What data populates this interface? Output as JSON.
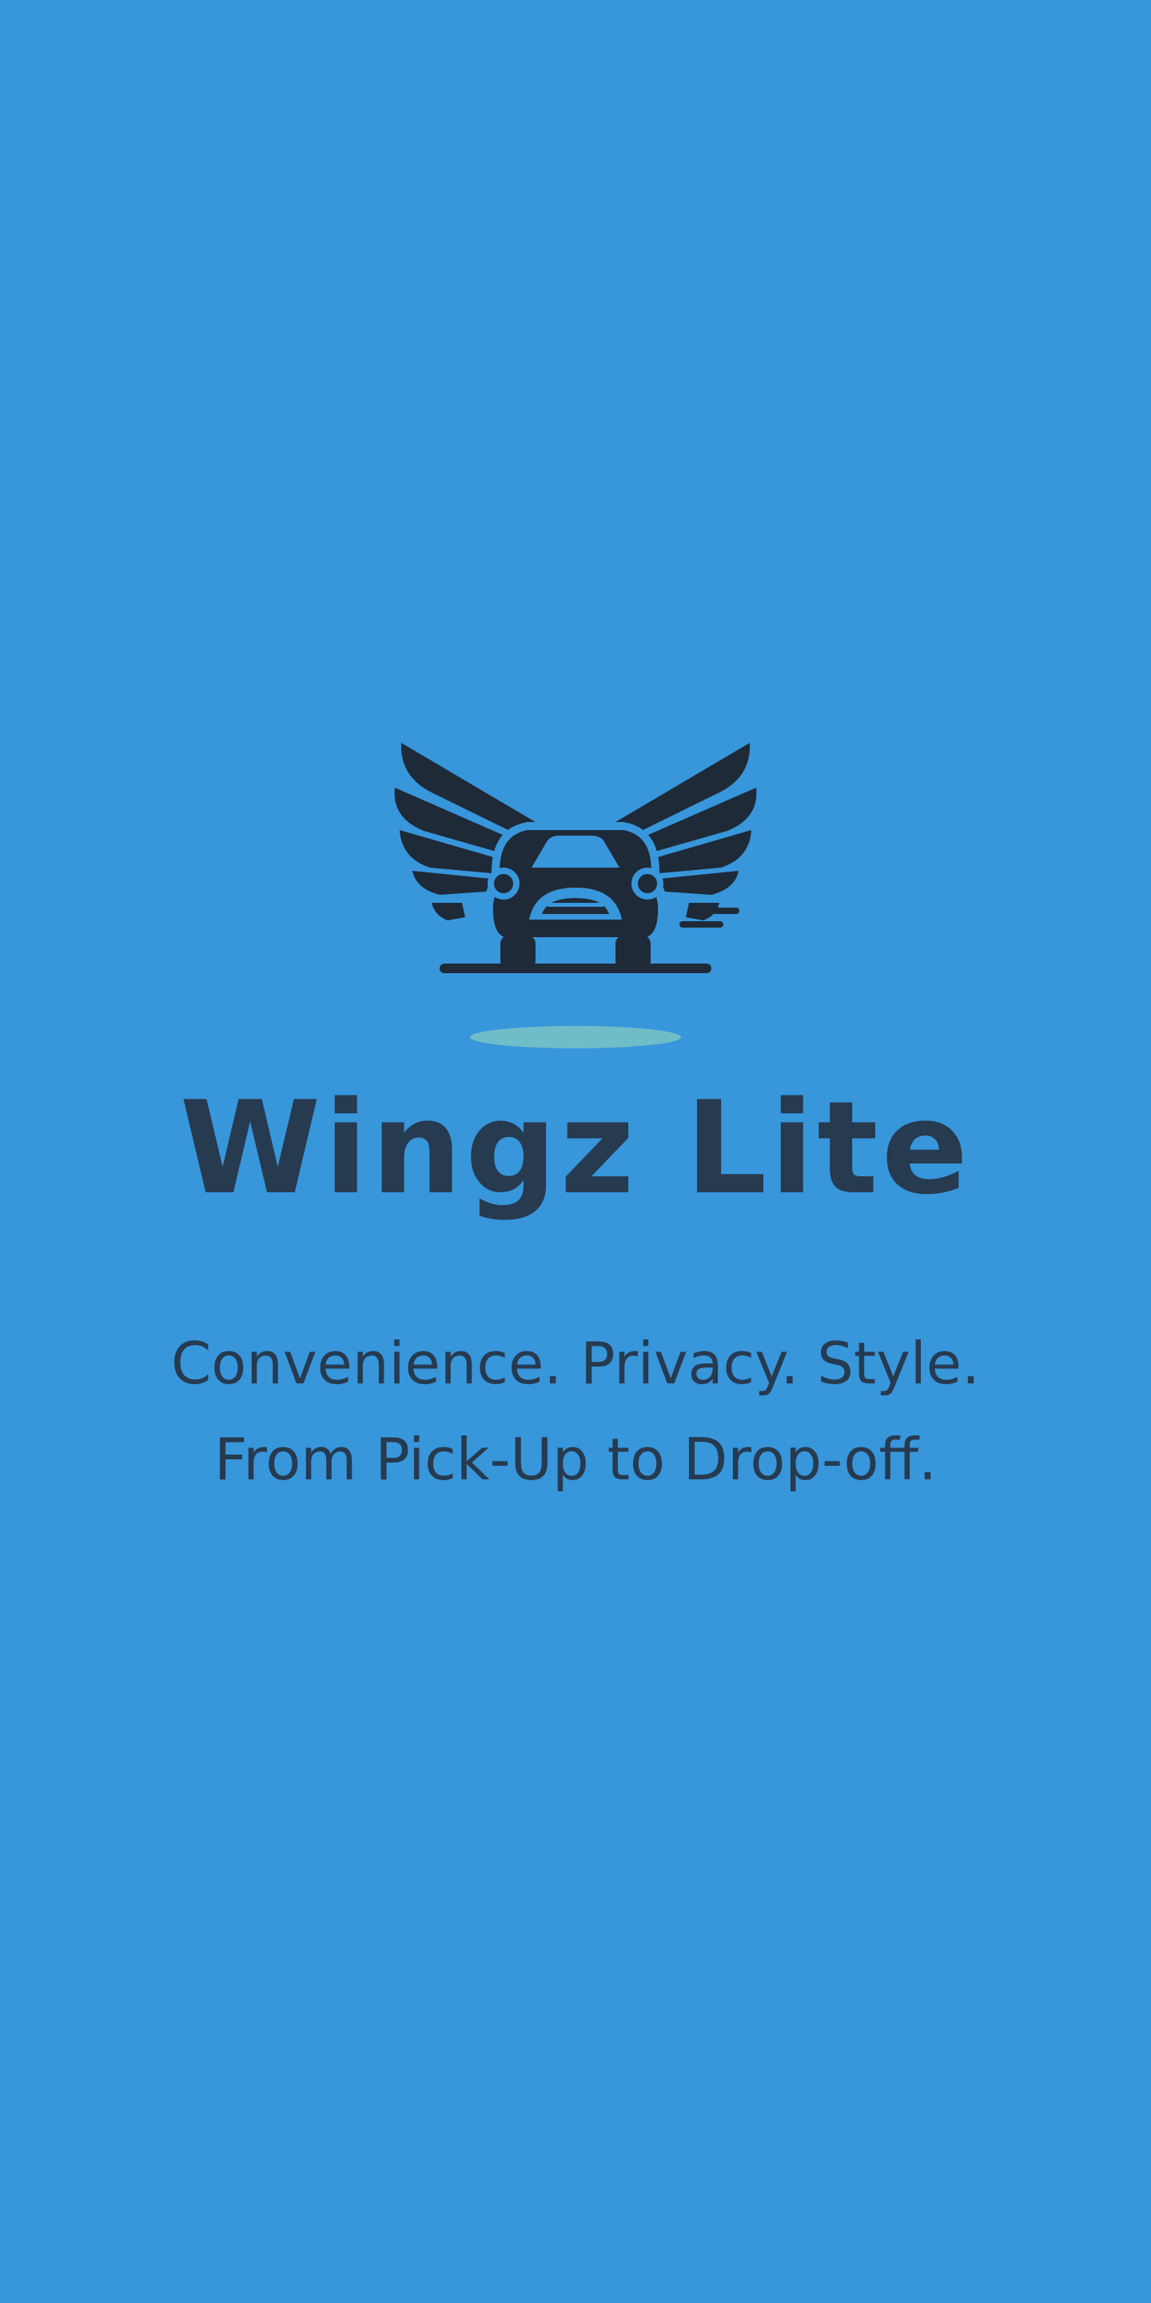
{
  "screen": {
    "name": "splash",
    "background_color": "#3896DB",
    "text_color": "#263A50"
  },
  "logo": {
    "icon": "winged-car-icon",
    "color": "#1E2A38",
    "shadow_color": "#6FBDC8"
  },
  "app": {
    "title": "Wingz Lite"
  },
  "tagline": {
    "line1": "Convenience. Privacy. Style.",
    "line2": "From Pick-Up to Drop-off."
  }
}
